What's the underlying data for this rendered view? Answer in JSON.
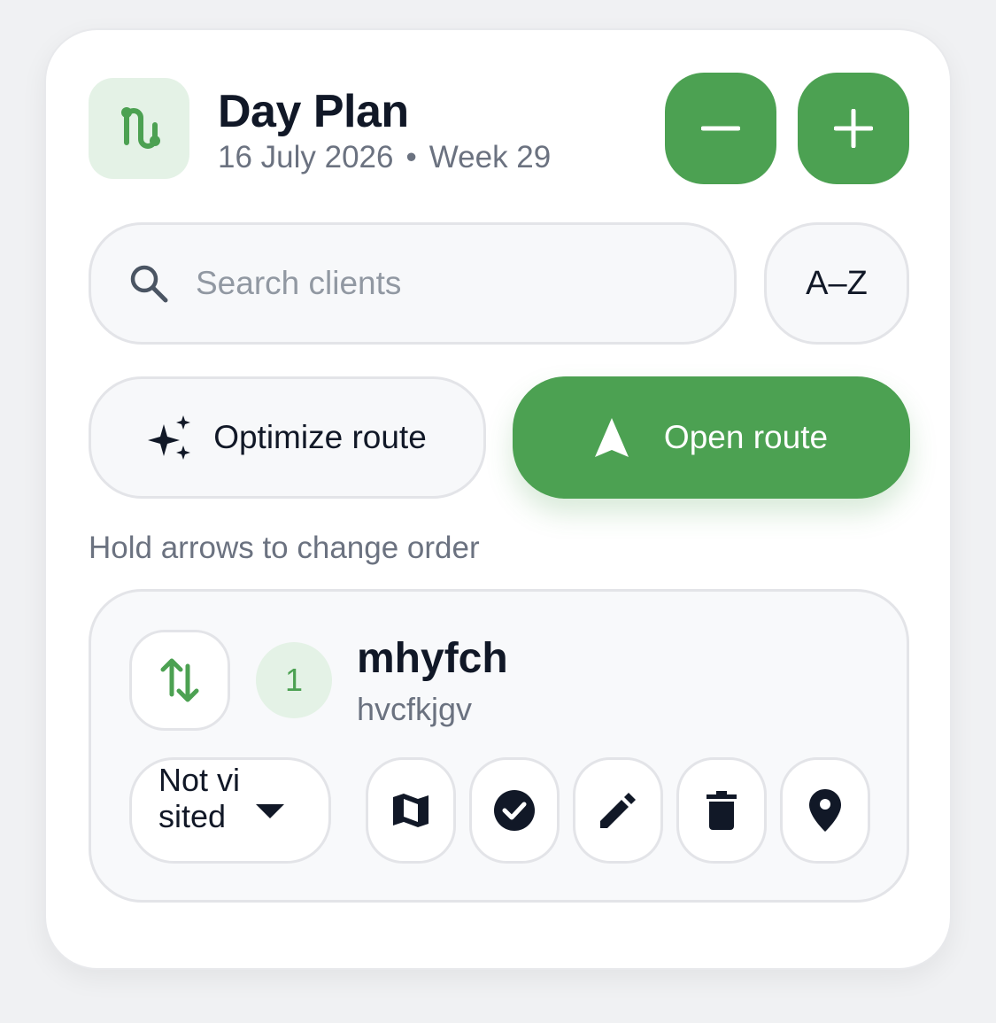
{
  "header": {
    "title": "Day Plan",
    "date": "16 July 2026",
    "separator": "•",
    "week": "Week 29",
    "logo_icon": "route-icon",
    "minus_icon": "minus-icon",
    "plus_icon": "plus-icon"
  },
  "search": {
    "placeholder": "Search clients",
    "value": "",
    "icon": "search-icon"
  },
  "sort": {
    "label": "A–Z"
  },
  "actions": {
    "optimize_label": "Optimize route",
    "optimize_icon": "sparkles-icon",
    "open_label": "Open route",
    "open_icon": "navigation-arrow-icon"
  },
  "hint": "Hold arrows to change order",
  "clients": [
    {
      "index": "1",
      "name": "mhyfch",
      "subtitle": "hvcfkjgv",
      "status": "Not visited",
      "actions": [
        "map-icon",
        "check-circle-icon",
        "pencil-icon",
        "trash-icon",
        "location-pin-icon"
      ]
    }
  ],
  "colors": {
    "accent": "#4ca152",
    "accent_soft": "#e4f2e6",
    "text_primary": "#111827",
    "text_secondary": "#6b7280"
  }
}
